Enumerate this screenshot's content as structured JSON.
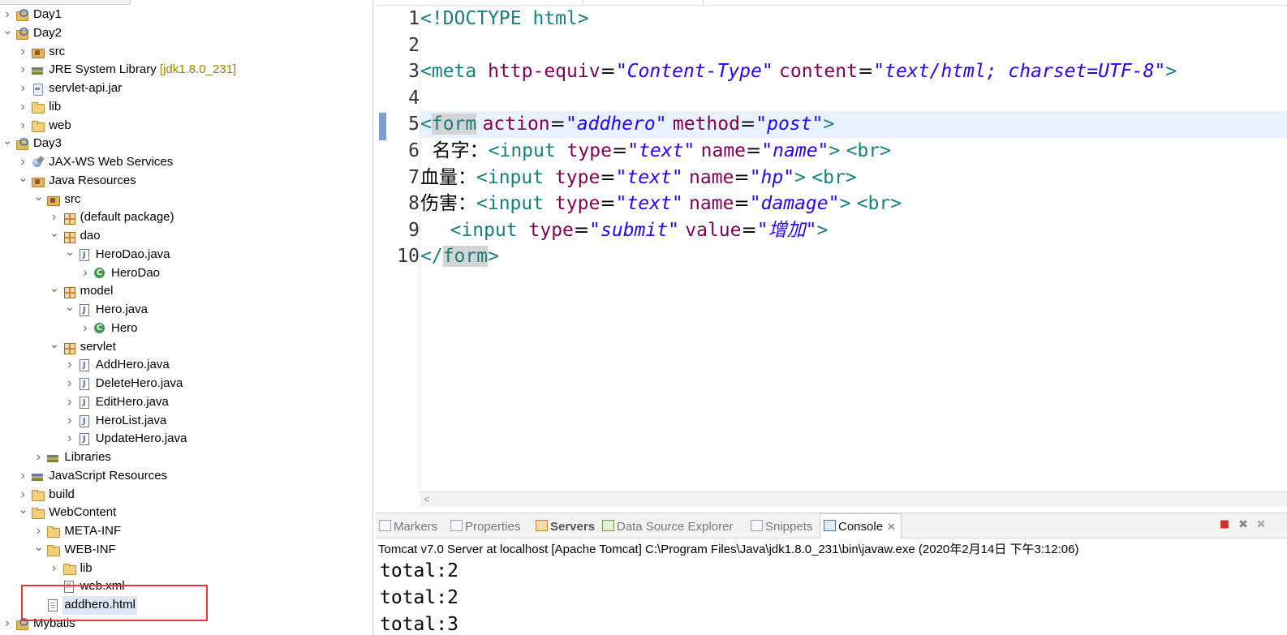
{
  "explorer": {
    "items": [
      {
        "label": "Day1",
        "icon": "project-icon",
        "depth": 0,
        "twisty": ">"
      },
      {
        "label": "Day2",
        "icon": "project-icon",
        "depth": 0,
        "twisty": "v"
      },
      {
        "label": "src",
        "icon": "source-folder-icon",
        "depth": 1,
        "twisty": ">"
      },
      {
        "label": "JRE System Library",
        "decoration": "[jdk1.8.0_231]",
        "icon": "library-icon",
        "depth": 1,
        "twisty": ">"
      },
      {
        "label": "servlet-api.jar",
        "icon": "jar-icon",
        "depth": 1,
        "twisty": ">"
      },
      {
        "label": "lib",
        "icon": "folder-icon",
        "depth": 1,
        "twisty": ">"
      },
      {
        "label": "web",
        "icon": "folder-icon",
        "depth": 1,
        "twisty": ">"
      },
      {
        "label": "Day3",
        "icon": "project-icon",
        "depth": 0,
        "twisty": "v"
      },
      {
        "label": "JAX-WS Web Services",
        "icon": "web-services-icon",
        "depth": 1,
        "twisty": ">"
      },
      {
        "label": "Java Resources",
        "icon": "source-folder-icon",
        "depth": 1,
        "twisty": "v"
      },
      {
        "label": "src",
        "icon": "source-folder-icon",
        "depth": 2,
        "twisty": "v"
      },
      {
        "label": "(default package)",
        "icon": "package-icon",
        "depth": 3,
        "twisty": ">"
      },
      {
        "label": "dao",
        "icon": "package-icon",
        "depth": 3,
        "twisty": "v"
      },
      {
        "label": "HeroDao.java",
        "icon": "java-file-icon",
        "depth": 4,
        "twisty": "v"
      },
      {
        "label": "HeroDao",
        "icon": "class-icon",
        "depth": 5,
        "twisty": ">"
      },
      {
        "label": "model",
        "icon": "package-icon",
        "depth": 3,
        "twisty": "v"
      },
      {
        "label": "Hero.java",
        "icon": "java-file-icon",
        "depth": 4,
        "twisty": "v"
      },
      {
        "label": "Hero",
        "icon": "class-icon",
        "depth": 5,
        "twisty": ">"
      },
      {
        "label": "servlet",
        "icon": "package-icon",
        "depth": 3,
        "twisty": "v"
      },
      {
        "label": "AddHero.java",
        "icon": "java-file-icon",
        "depth": 4,
        "twisty": ">"
      },
      {
        "label": "DeleteHero.java",
        "icon": "java-file-icon",
        "depth": 4,
        "twisty": ">"
      },
      {
        "label": "EditHero.java",
        "icon": "java-file-icon",
        "depth": 4,
        "twisty": ">"
      },
      {
        "label": "HeroList.java",
        "icon": "java-file-icon",
        "depth": 4,
        "twisty": ">"
      },
      {
        "label": "UpdateHero.java",
        "icon": "java-file-icon",
        "depth": 4,
        "twisty": ">"
      },
      {
        "label": "Libraries",
        "icon": "library-icon",
        "depth": 2,
        "twisty": ">"
      },
      {
        "label": "JavaScript Resources",
        "icon": "library-icon",
        "depth": 1,
        "twisty": ">"
      },
      {
        "label": "build",
        "icon": "folder-icon",
        "depth": 1,
        "twisty": ">"
      },
      {
        "label": "WebContent",
        "icon": "folder-icon",
        "depth": 1,
        "twisty": "v"
      },
      {
        "label": "META-INF",
        "icon": "folder-icon",
        "depth": 2,
        "twisty": ">"
      },
      {
        "label": "WEB-INF",
        "icon": "folder-icon",
        "depth": 2,
        "twisty": "v"
      },
      {
        "label": "lib",
        "icon": "folder-icon",
        "depth": 3,
        "twisty": ">"
      },
      {
        "label": "web.xml",
        "icon": "xml-file-icon",
        "depth": 3,
        "twisty": ""
      },
      {
        "label": "addhero.html",
        "icon": "html-file-icon",
        "depth": 2,
        "twisty": "",
        "selected": true,
        "highlighted": true
      },
      {
        "label": "Mybatis",
        "icon": "project-icon",
        "depth": 0,
        "twisty": ">"
      }
    ]
  },
  "editor": {
    "line_numbers": [
      "1",
      "2",
      "3",
      "4",
      "5",
      "6",
      "7",
      "8",
      "9",
      "10"
    ],
    "current_line": 5,
    "lines": [
      [
        {
          "t": "<!DOCTYPE html>",
          "c": "tg"
        }
      ],
      [],
      [
        {
          "t": "<meta ",
          "c": "tg"
        },
        {
          "t": "http-equiv",
          "c": "at"
        },
        {
          "t": "=",
          "c": "tx"
        },
        {
          "t": "\"Content-Type\"",
          "c": "av"
        },
        {
          "t": " ",
          "c": "tx"
        },
        {
          "t": "content",
          "c": "at"
        },
        {
          "t": "=",
          "c": "tx"
        },
        {
          "t": "\"text/html; charset=UTF-8\"",
          "c": "av"
        },
        {
          "t": ">",
          "c": "tg"
        }
      ],
      [],
      [
        {
          "t": "<",
          "c": "tg"
        },
        {
          "t": "form",
          "c": "tg hl"
        },
        {
          "t": " ",
          "c": "tx"
        },
        {
          "t": "action",
          "c": "at"
        },
        {
          "t": "=",
          "c": "tx"
        },
        {
          "t": "\"addhero\"",
          "c": "av"
        },
        {
          "t": " ",
          "c": "tx"
        },
        {
          "t": "method",
          "c": "at"
        },
        {
          "t": "=",
          "c": "tx"
        },
        {
          "t": "\"post\"",
          "c": "av"
        },
        {
          "t": ">",
          "c": "tg"
        }
      ],
      [
        {
          "t": "  名字：",
          "c": "tx"
        },
        {
          "t": "<input ",
          "c": "tg"
        },
        {
          "t": "type",
          "c": "at"
        },
        {
          "t": "=",
          "c": "tx"
        },
        {
          "t": "\"text\"",
          "c": "av"
        },
        {
          "t": " ",
          "c": "tx"
        },
        {
          "t": "name",
          "c": "at"
        },
        {
          "t": "=",
          "c": "tx"
        },
        {
          "t": "\"name\"",
          "c": "av"
        },
        {
          "t": ">",
          "c": "tg"
        },
        {
          "t": " ",
          "c": "tx"
        },
        {
          "t": "<br>",
          "c": "tg"
        }
      ],
      [
        {
          "t": "血量：",
          "c": "tx"
        },
        {
          "t": "<input ",
          "c": "tg"
        },
        {
          "t": "type",
          "c": "at"
        },
        {
          "t": "=",
          "c": "tx"
        },
        {
          "t": "\"text\"",
          "c": "av"
        },
        {
          "t": " ",
          "c": "tx"
        },
        {
          "t": "name",
          "c": "at"
        },
        {
          "t": "=",
          "c": "tx"
        },
        {
          "t": "\"hp\"",
          "c": "av"
        },
        {
          "t": ">",
          "c": "tg"
        },
        {
          "t": " ",
          "c": "tx"
        },
        {
          "t": "<br>",
          "c": "tg"
        }
      ],
      [
        {
          "t": "伤害：",
          "c": "tx"
        },
        {
          "t": "<input ",
          "c": "tg"
        },
        {
          "t": "type",
          "c": "at"
        },
        {
          "t": "=",
          "c": "tx"
        },
        {
          "t": "\"text\"",
          "c": "av"
        },
        {
          "t": " ",
          "c": "tx"
        },
        {
          "t": "name",
          "c": "at"
        },
        {
          "t": "=",
          "c": "tx"
        },
        {
          "t": "\"damage\"",
          "c": "av"
        },
        {
          "t": ">",
          "c": "tg"
        },
        {
          "t": " ",
          "c": "tx"
        },
        {
          "t": "<br>",
          "c": "tg"
        }
      ],
      [
        {
          "t": "     ",
          "c": "tx"
        },
        {
          "t": "<input ",
          "c": "tg"
        },
        {
          "t": "type",
          "c": "at"
        },
        {
          "t": "=",
          "c": "tx"
        },
        {
          "t": "\"submit\"",
          "c": "av"
        },
        {
          "t": " ",
          "c": "tx"
        },
        {
          "t": "value",
          "c": "at"
        },
        {
          "t": "=",
          "c": "tx"
        },
        {
          "t": "\"增加\"",
          "c": "av"
        },
        {
          "t": ">",
          "c": "tg"
        }
      ],
      [
        {
          "t": "</",
          "c": "tg"
        },
        {
          "t": "form",
          "c": "tg hl"
        },
        {
          "t": ">",
          "c": "tg"
        }
      ]
    ],
    "scroll_left_icon": "chevron-left-icon"
  },
  "panel": {
    "tabs": [
      {
        "label": "Markers",
        "icon": "markers-icon"
      },
      {
        "label": "Properties",
        "icon": "properties-icon"
      },
      {
        "label": "Servers",
        "icon": "servers-icon",
        "bold": true
      },
      {
        "label": "Data Source Explorer",
        "icon": "data-source-icon"
      },
      {
        "label": "Snippets",
        "icon": "snippets-icon"
      },
      {
        "label": "Console",
        "icon": "console-icon",
        "active": true,
        "close": "✕"
      }
    ],
    "toolbar": {
      "stop": "■",
      "remove": "✖",
      "remove_all": "✖"
    },
    "console_title": "Tomcat v7.0 Server at localhost [Apache Tomcat] C:\\Program Files\\Java\\jdk1.8.0_231\\bin\\javaw.exe (2020年2月14日 下午3:12:06)",
    "console_lines": [
      "total:2",
      "total:2",
      "total:3"
    ]
  },
  "colors": {
    "tag": "#17807e",
    "attribute": "#7f0055",
    "attribute_value": "#2a00ff",
    "current_line": "#e8f2fe",
    "selection_box": "#e53935",
    "stop_red": "#d32f2f"
  }
}
